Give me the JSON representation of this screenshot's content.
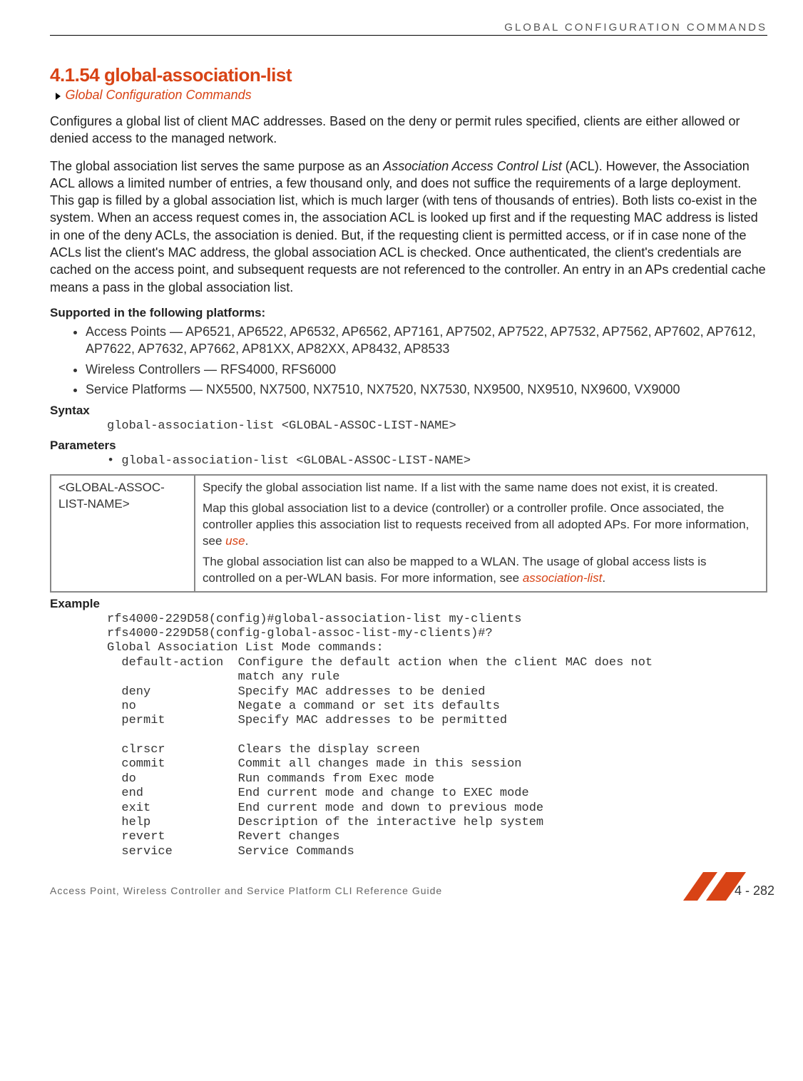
{
  "header": {
    "category": "GLOBAL CONFIGURATION COMMANDS"
  },
  "section": {
    "number_title": "4.1.54 global-association-list",
    "breadcrumb_link": "Global Configuration Commands"
  },
  "paragraphs": {
    "p1": "Configures a global list of client MAC addresses. Based on the deny or permit rules specified, clients are either allowed or denied access to the managed network.",
    "p2_a": "The global association list serves the same purpose as an ",
    "p2_italic": "Association Access Control List",
    "p2_b": " (ACL). However, the Association ACL allows a limited number of entries, a few thousand only, and does not suffice the requirements of a large deployment. This gap is filled by a global association list, which is much larger (with tens of thousands of entries). Both lists co-exist in the system. When an access request comes in, the association ACL is looked up first and if the requesting MAC address is listed in one of the deny ACLs, the association is denied. But, if the requesting client is permitted access, or if in case none of the ACLs list the client's MAC address, the global association ACL is checked. Once authenticated, the client's credentials are cached on the access point, and subsequent requests are not referenced to the controller. An entry in an APs credential cache means a pass in the global association list."
  },
  "supported": {
    "heading": "Supported in the following platforms:",
    "items": [
      "Access Points — AP6521, AP6522, AP6532, AP6562, AP7161, AP7502, AP7522, AP7532, AP7562, AP7602, AP7612, AP7622, AP7632, AP7662, AP81XX, AP82XX, AP8432, AP8533",
      "Wireless Controllers — RFS4000, RFS6000",
      "Service Platforms — NX5500, NX7500, NX7510, NX7520, NX7530, NX9500, NX9510, NX9600, VX9000"
    ]
  },
  "syntax": {
    "heading": "Syntax",
    "code": "global-association-list <GLOBAL-ASSOC-LIST-NAME>"
  },
  "parameters": {
    "heading": "Parameters",
    "usage_line": "global-association-list <GLOBAL-ASSOC-LIST-NAME>",
    "table": {
      "param_name": "<GLOBAL-ASSOC-LIST-NAME>",
      "desc_p1": "Specify the global association list name. If a list with the same name does not exist, it is created.",
      "desc_p2_a": "Map this global association list to a device (controller) or a controller profile. Once associated, the controller applies this association list to requests received from all adopted APs. For more information, see ",
      "desc_p2_link": "use",
      "desc_p2_b": ".",
      "desc_p3_a": "The global association list can also be mapped to a WLAN. The usage of global access lists is controlled on a per-WLAN basis. For more information, see ",
      "desc_p3_link": "association-list",
      "desc_p3_b": "."
    }
  },
  "example": {
    "heading": "Example",
    "code": "rfs4000-229D58(config)#global-association-list my-clients\nrfs4000-229D58(config-global-assoc-list-my-clients)#?\nGlobal Association List Mode commands:\n  default-action  Configure the default action when the client MAC does not\n                  match any rule\n  deny            Specify MAC addresses to be denied\n  no              Negate a command or set its defaults\n  permit          Specify MAC addresses to be permitted\n\n  clrscr          Clears the display screen\n  commit          Commit all changes made in this session\n  do              Run commands from Exec mode\n  end             End current mode and change to EXEC mode\n  exit            End current mode and down to previous mode\n  help            Description of the interactive help system\n  revert          Revert changes\n  service         Service Commands"
  },
  "footer": {
    "guide_title": "Access Point, Wireless Controller and Service Platform CLI Reference Guide",
    "page_number": "4 - 282"
  }
}
